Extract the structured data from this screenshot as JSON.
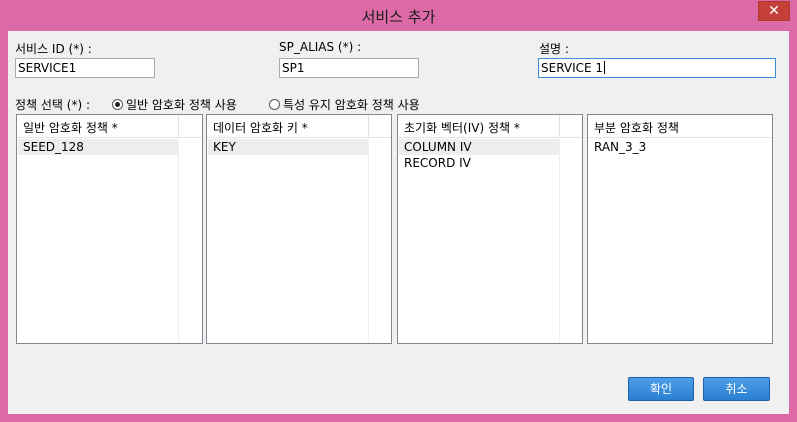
{
  "window": {
    "title": "서비스 추가",
    "close_label": "✕"
  },
  "form": {
    "service_id_label": "서비스 ID (*) :",
    "service_id_value": "SERVICE1",
    "sp_alias_label": "SP_ALIAS (*) :",
    "sp_alias_value": "SP1",
    "description_label": "설명 :",
    "description_value": "SERVICE 1"
  },
  "policy_select": {
    "label": "정책 선택 (*) :",
    "options": [
      {
        "label": "일반 암호화 정책 사용",
        "checked": true
      },
      {
        "label": "특성 유지 암호화 정책 사용",
        "checked": false
      }
    ]
  },
  "panels": [
    {
      "header": "일반 암호화 정책 *",
      "items": [
        "SEED_128"
      ],
      "selected": 0
    },
    {
      "header": "데이터 암호화 키 *",
      "items": [
        "KEY"
      ],
      "selected": 0
    },
    {
      "header": "초기화 벡터(IV) 정책 *",
      "items": [
        "COLUMN IV",
        "RECORD IV"
      ],
      "selected": 0
    },
    {
      "header": "부분 암호화 정책",
      "items": [
        "RAN_3_3"
      ],
      "selected": -1
    }
  ],
  "buttons": {
    "confirm": "확인",
    "cancel": "취소"
  },
  "colors": {
    "frame": "#dc6aa6",
    "accent": "#2b7fd1",
    "close": "#c6403a"
  }
}
